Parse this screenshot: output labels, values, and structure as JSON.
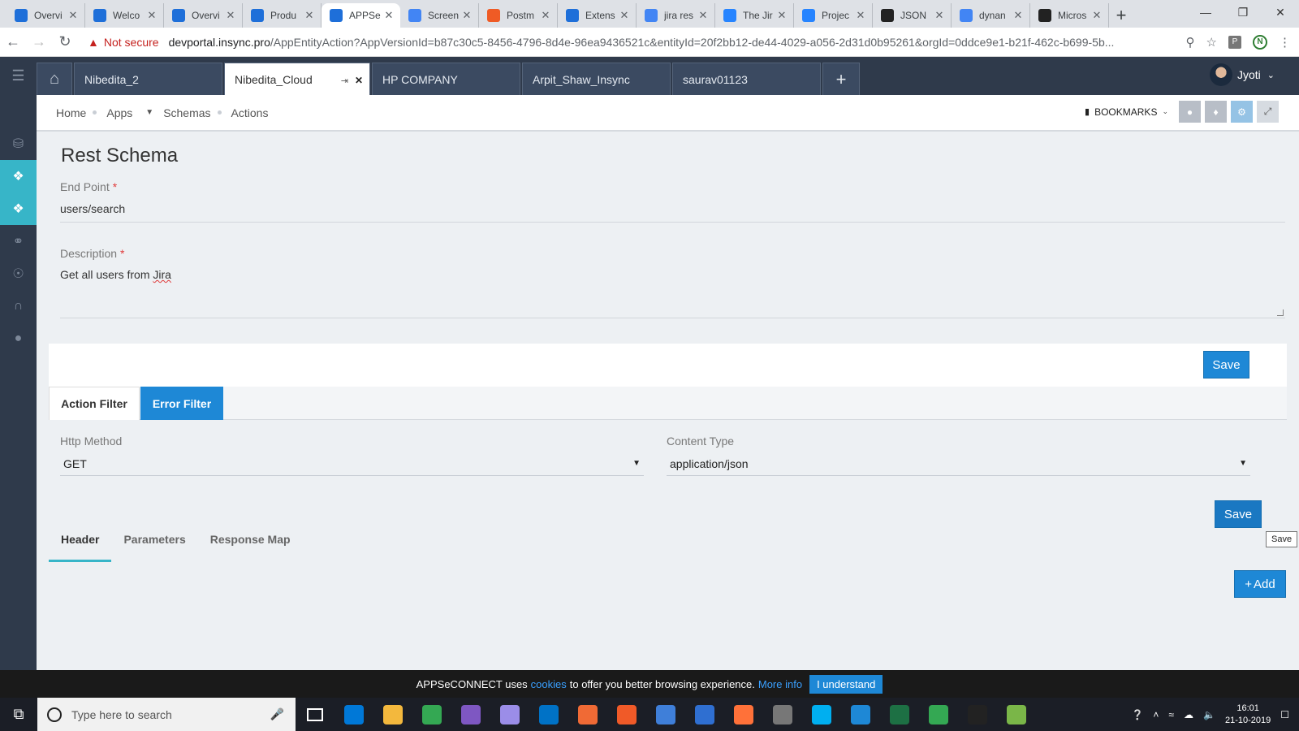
{
  "browser": {
    "tabs": [
      {
        "label": "Overvi",
        "color": "#1e6fd9"
      },
      {
        "label": "Welco",
        "color": "#1e6fd9"
      },
      {
        "label": "Overvi",
        "color": "#1e6fd9"
      },
      {
        "label": "Produ",
        "color": "#1e6fd9"
      },
      {
        "label": "APPSe",
        "color": "#1e6fd9",
        "active": true
      },
      {
        "label": "Screen",
        "color": "#4285f4"
      },
      {
        "label": "Postm",
        "color": "#ef5b25"
      },
      {
        "label": "Extens",
        "color": "#1e6fd9"
      },
      {
        "label": "jira res",
        "color": "#4285f4"
      },
      {
        "label": "The Jir",
        "color": "#2684ff"
      },
      {
        "label": "Projec",
        "color": "#2684ff"
      },
      {
        "label": "JSON",
        "color": "#222222"
      },
      {
        "label": "dynan",
        "color": "#4285f4"
      },
      {
        "label": "Micros",
        "color": "#222222"
      }
    ],
    "address": {
      "security_label": "Not secure",
      "host": "devportal.insync.pro",
      "path": "/AppEntityAction?AppVersionId=b87c30c5-8456-4796-8d4e-96ea9436521c&entityId=20f2bb12-de44-4029-a056-2d31d0b95261&orgId=0ddce9e1-b21f-462c-b699-5b..."
    },
    "extension_label": "P",
    "profile_initial": "N"
  },
  "app": {
    "org_tabs": [
      {
        "label": "Nibedita_2"
      },
      {
        "label": "Nibedita_Cloud",
        "active": true
      },
      {
        "label": "HP COMPANY"
      },
      {
        "label": "Arpit_Shaw_Insync"
      },
      {
        "label": "saurav01123"
      }
    ],
    "user_name": "Jyoti",
    "breadcrumb": {
      "home": "Home",
      "apps": "Apps",
      "schemas": "Schemas",
      "actions": "Actions"
    },
    "bookmarks_label": "BOOKMARKS"
  },
  "form": {
    "title": "Rest Schema",
    "endpoint_label": "End Point",
    "endpoint_value": "users/search",
    "description_label": "Description",
    "description_prefix": "Get all users from ",
    "description_word": "Jira",
    "required_mark": "*",
    "save_label": "Save",
    "filter_tabs": {
      "action": "Action Filter",
      "error": "Error Filter"
    },
    "http_method_label": "Http Method",
    "http_method_value": "GET",
    "content_type_label": "Content Type",
    "content_type_value": "application/json",
    "save2_label": "Save",
    "tooltip": "Save",
    "sub_tabs": {
      "header": "Header",
      "parameters": "Parameters",
      "response_map": "Response Map"
    },
    "add_label": "Add"
  },
  "cookie": {
    "prefix": "APPSeCONNECT uses",
    "link": "cookies",
    "middle": "to offer you better browsing experience.",
    "more": "More info",
    "button": "I understand"
  },
  "taskbar": {
    "search_placeholder": "Type here to search",
    "time": "16:01",
    "date": "21-10-2019",
    "icon_colors": [
      "#0078d7",
      "#f3b83d",
      "#34a853",
      "#7e57c2",
      "#9b8de8",
      "#0072c6",
      "#f06a35",
      "#f05a28",
      "#3f7fd9",
      "#2f6fd1",
      "#ff7139",
      "#777777",
      "#00aff0",
      "#1e88d6",
      "#1d7044",
      "#34a853",
      "#222222",
      "#7ab648"
    ]
  }
}
